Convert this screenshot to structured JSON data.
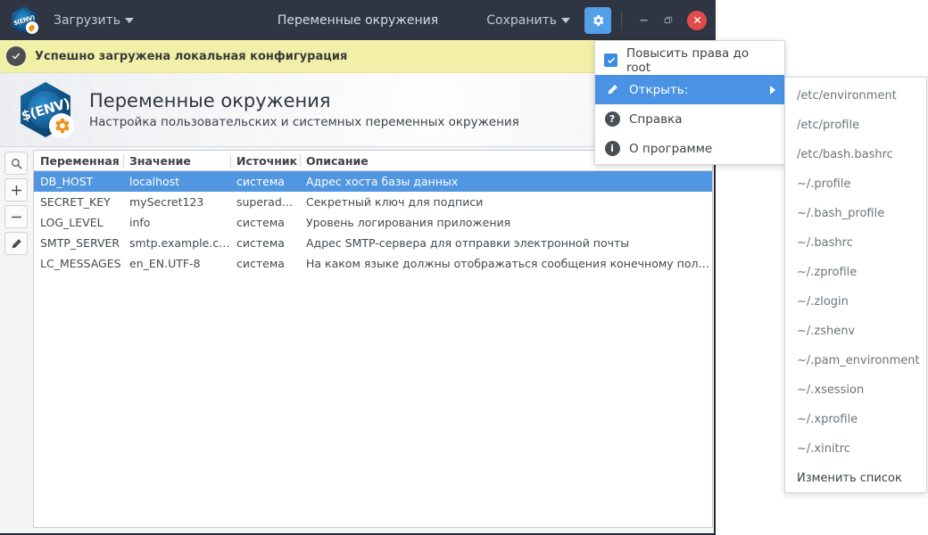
{
  "titlebar": {
    "logo_text": "$(ENV)",
    "load_label": "Загрузить",
    "title": "Переменные окружения",
    "save_label": "Сохранить",
    "gear_icon": "gear-icon",
    "minimize_icon": "minimize-icon",
    "maximize_icon": "maximize-icon",
    "close_icon": "close-icon"
  },
  "notification": {
    "icon": "check-circle-icon",
    "text": "Успешно загружена локальная конфигурация"
  },
  "banner": {
    "logo_text": "$(ENV)",
    "title": "Переменные окружения",
    "subtitle": "Настройка пользовательских и системных переменных окружения"
  },
  "toolbar": {
    "buttons": [
      {
        "name": "search-button",
        "icon": "search-icon"
      },
      {
        "name": "add-button",
        "icon": "plus-icon"
      },
      {
        "name": "remove-button",
        "icon": "minus-icon"
      },
      {
        "name": "edit-button",
        "icon": "pencil-icon"
      }
    ]
  },
  "table": {
    "columns": [
      "Переменная",
      "Значение",
      "Источник",
      "Описание"
    ],
    "rows": [
      {
        "variable": "DB_HOST",
        "value": "localhost",
        "source": "система",
        "description": "Адрес хоста базы данных",
        "selected": true
      },
      {
        "variable": "SECRET_KEY",
        "value": "mySecret123",
        "source": "superadmin",
        "description": "Секретный ключ для подписи",
        "selected": false
      },
      {
        "variable": "LOG_LEVEL",
        "value": "info",
        "source": "система",
        "description": "Уровень логирования приложения",
        "selected": false
      },
      {
        "variable": "SMTP_SERVER",
        "value": "smtp.example.com",
        "source": "система",
        "description": "Адрес SMTP-сервера для отправки электронной почты",
        "selected": false
      },
      {
        "variable": "LC_MESSAGES",
        "value": "en_EN.UTF-8",
        "source": "система",
        "description": "На каком языке должны отображаться сообщения конечному пользо…",
        "selected": false
      }
    ]
  },
  "gear_menu": {
    "items": [
      {
        "label": "Повысить права до root",
        "icon": "checkbox-checked-icon",
        "type": "checkbox",
        "checked": true,
        "active": false
      },
      {
        "label": "Открыть:",
        "icon": "pencil-icon",
        "type": "submenu",
        "active": true
      },
      {
        "label": "Справка",
        "icon": "help-icon",
        "type": "item",
        "active": false
      },
      {
        "label": "О программе",
        "icon": "info-icon",
        "type": "item",
        "active": false
      }
    ]
  },
  "open_submenu": {
    "items": [
      {
        "label": "/etc/environment",
        "strong": false
      },
      {
        "label": "/etc/profile",
        "strong": false
      },
      {
        "label": "/etc/bash.bashrc",
        "strong": false
      },
      {
        "label": "~/.profile",
        "strong": false
      },
      {
        "label": "~/.bash_profile",
        "strong": false
      },
      {
        "label": "~/.bashrc",
        "strong": false
      },
      {
        "label": "~/.zprofile",
        "strong": false
      },
      {
        "label": "~/.zlogin",
        "strong": false
      },
      {
        "label": "~/.zshenv",
        "strong": false
      },
      {
        "label": "~/.pam_environment",
        "strong": false
      },
      {
        "label": "~/.xsession",
        "strong": false
      },
      {
        "label": "~/.xprofile",
        "strong": false
      },
      {
        "label": "~/.xinitrc",
        "strong": false
      },
      {
        "label": "Изменить список",
        "strong": true
      }
    ]
  },
  "colors": {
    "titlebar": "#2f3542",
    "accent_blue": "#5196e0",
    "gear_button": "#54a0e8",
    "notification_bg": "#f2f0a8",
    "close_red": "#e14b4b",
    "logo_orange": "#f0911e"
  }
}
